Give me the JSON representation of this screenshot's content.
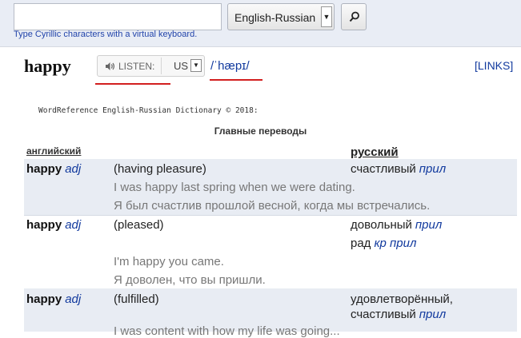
{
  "search": {
    "value": "",
    "placeholder": ""
  },
  "dictionary": {
    "selected": "English-Russian"
  },
  "keyboard_hint": "Type Cyrillic characters with a virtual keyboard.",
  "entry": {
    "headword": "happy",
    "listen_label": "LISTEN:",
    "accent": "US",
    "pronunciation": "/ˈhæpɪ/",
    "links_label": "[LINKS]"
  },
  "copyright": "WordReference English-Russian Dictionary © 2018:",
  "section_title": "Главные переводы",
  "columns": {
    "english": "английский",
    "russian": "русский"
  },
  "rows": [
    {
      "word": "happy",
      "pos": "adj",
      "sense": "(having pleasure)",
      "translations": [
        {
          "text": "счастливый",
          "pos": "прил"
        }
      ],
      "example_en": "I was happy last spring when we were dating.",
      "example_ru": "Я был счастлив прошлой весной, когда мы встречались."
    },
    {
      "word": "happy",
      "pos": "adj",
      "sense": "(pleased)",
      "translations": [
        {
          "text": "довольный",
          "pos": "прил"
        },
        {
          "text": "рад",
          "pos": "кр прил"
        }
      ],
      "example_en": "I'm happy you came.",
      "example_ru": "Я доволен, что вы пришли."
    },
    {
      "word": "happy",
      "pos": "adj",
      "sense": "(fulfilled)",
      "translations": [
        {
          "text": "удовлетворённый,",
          "pos": ""
        },
        {
          "text": "счастливый",
          "pos": "прил"
        }
      ],
      "example_en": "I was content with how my life was going...",
      "example_ru": ""
    }
  ],
  "colors": {
    "link": "#123a9e",
    "row_alt": "#e8ecf3",
    "annotation": "#d21f1f"
  }
}
